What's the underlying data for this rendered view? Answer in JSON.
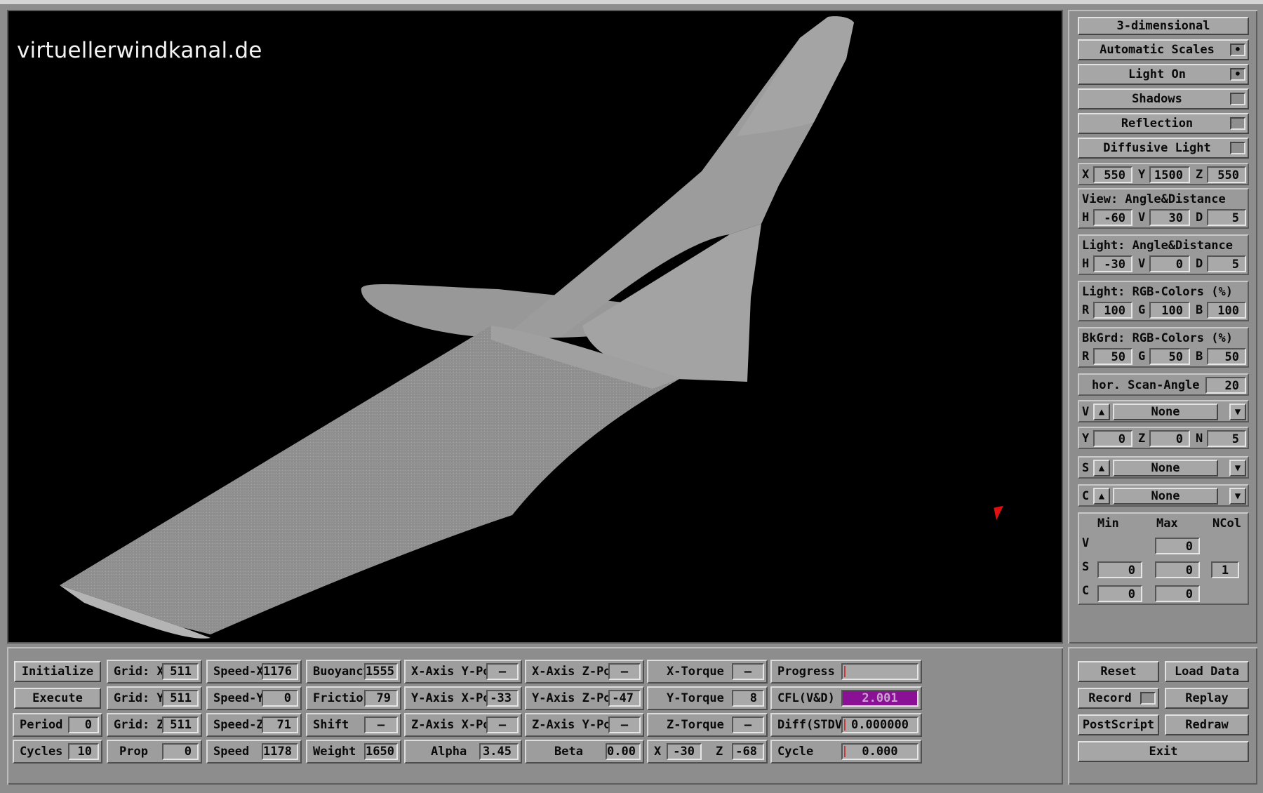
{
  "watermark": "virtuellerwindkanal.de",
  "right_panel": {
    "mode_label": "3-dimensional",
    "toggles": [
      {
        "label": "Automatic Scales",
        "checked": true
      },
      {
        "label": "Light On",
        "checked": true
      },
      {
        "label": "Shadows",
        "checked": false
      },
      {
        "label": "Reflection",
        "checked": false
      },
      {
        "label": "Diffusive Light",
        "checked": false
      }
    ],
    "position": {
      "x_label": "X",
      "x": "550",
      "y_label": "Y",
      "y": "1500",
      "z_label": "Z",
      "z": "550"
    },
    "view": {
      "title": "View:  Angle&Distance",
      "h_label": "H",
      "h": "-60",
      "v_label": "V",
      "v": "30",
      "d_label": "D",
      "d": "5"
    },
    "light_angle": {
      "title": "Light: Angle&Distance",
      "h_label": "H",
      "h": "-30",
      "v_label": "V",
      "v": "0",
      "d_label": "D",
      "d": "5"
    },
    "light_rgb": {
      "title": "Light: RGB-Colors (%)",
      "r_label": "R",
      "r": "100",
      "g_label": "G",
      "g": "100",
      "b_label": "B",
      "b": "100"
    },
    "bkgrd_rgb": {
      "title": "BkGrd: RGB-Colors (%)",
      "r_label": "R",
      "r": "50",
      "g_label": "G",
      "g": "50",
      "b_label": "B",
      "b": "50"
    },
    "scan_angle": {
      "label": "hor. Scan-Angle",
      "value": "20"
    },
    "v_select": {
      "label": "V",
      "up": "▲",
      "value": "None",
      "down": "▼"
    },
    "yzn": {
      "y_label": "Y",
      "y": "0",
      "z_label": "Z",
      "z": "0",
      "n_label": "N",
      "n": "5"
    },
    "s_select": {
      "label": "S",
      "up": "▲",
      "value": "None",
      "down": "▼"
    },
    "c_select": {
      "label": "C",
      "up": "▲",
      "value": "None",
      "down": "▼"
    },
    "scale_table": {
      "min_label": "Min",
      "max_label": "Max",
      "ncol_label": "NCol",
      "v_label": "V",
      "v_max": "0",
      "s_label": "S",
      "s_min": "0",
      "s_max": "0",
      "s_ncol": "1",
      "c_label": "C",
      "c_min": "0",
      "c_max": "0"
    }
  },
  "bottom": {
    "initialize": "Initialize",
    "execute": "Execute",
    "period_label": "Period",
    "period": "0",
    "cycles_label": "Cycles",
    "cycles": "10",
    "grid_x_label": "Grid: X",
    "grid_x": "511",
    "grid_y_label": "Grid: Y",
    "grid_y": "511",
    "grid_z_label": "Grid: Z",
    "grid_z": "511",
    "prop_label": "Prop",
    "prop": "0",
    "speed_x_label": "Speed-X",
    "speed_x": "1176",
    "speed_y_label": "Speed-Y",
    "speed_y": "0",
    "speed_z_label": "Speed-Z",
    "speed_z": "71",
    "speed_label": "Speed",
    "speed": "1178",
    "buoyancy_label": "Buoyancy",
    "buoyancy": "1555",
    "friction_label": "Friction",
    "friction": "79",
    "shift_label": "Shift",
    "shift": "—",
    "weight_label": "Weight",
    "weight": "1650",
    "x_axis_y_pos_label": "X-Axis Y-Pos",
    "x_axis_y_pos": "—",
    "y_axis_x_pos_label": "Y-Axis X-Pos",
    "y_axis_x_pos": "-33",
    "z_axis_x_pos_label": "Z-Axis X-Pos",
    "z_axis_x_pos": "—",
    "alpha_label": "Alpha",
    "alpha": "3.45",
    "x_axis_z_pos_label": "X-Axis Z-Pos",
    "x_axis_z_pos": "—",
    "y_axis_z_pos_label": "Y-Axis Z-Pos",
    "y_axis_z_pos": "-47",
    "z_axis_y_pos_label": "Z-Axis Y-Pos",
    "z_axis_y_pos": "—",
    "beta_label": "Beta",
    "beta": "0.00",
    "x_torque_label": "X-Torque",
    "x_torque": "—",
    "y_torque_label": "Y-Torque",
    "y_torque": "8",
    "z_torque_label": "Z-Torque",
    "z_torque": "—",
    "x_label": "X",
    "x": "-30",
    "z_label": "Z",
    "z": "-68",
    "progress_label": "Progress",
    "progress": 0.0,
    "cfl_label": "CFL(V&D)",
    "cfl": "2.001",
    "diff_label": "Diff(STDV)",
    "diff": "0.000000",
    "cycle_label": "Cycle",
    "cycle": "0.000",
    "colors": {
      "cfl_bg": "#8a1096"
    }
  },
  "bottom_right": {
    "reset": "Reset",
    "load_data": "Load Data",
    "record": "Record",
    "replay": "Replay",
    "postscript": "PostScript",
    "redraw": "Redraw",
    "exit": "Exit"
  }
}
